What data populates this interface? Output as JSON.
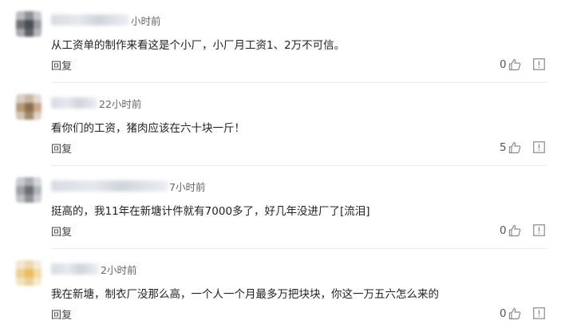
{
  "icons": {
    "like": "thumbs-up-icon",
    "report": "report-icon"
  },
  "colors": {
    "text": "#222222",
    "muted": "#666666",
    "icon": "#8a8a8a",
    "divider": "#ececec"
  },
  "comments": [
    {
      "time": "小时前",
      "content": "从工资单的制作来看这是个小厂，小厂月工资1、2万不可信。",
      "reply_label": "回复",
      "likes": "0"
    },
    {
      "time": "22小时前",
      "content": "看你们的工资，猪肉应该在六十块一斤！",
      "reply_label": "回复",
      "likes": "5"
    },
    {
      "time": "7小时前",
      "content": "挺高的，我11年在新塘计件就有7000多了，好几年没进厂了[流泪]",
      "reply_label": "回复",
      "likes": "0"
    },
    {
      "time": "2小时前",
      "content": "我在新塘，制衣厂没那么高，一个人一个月最多万把块块，你这一万五六怎么来的",
      "reply_label": "回复",
      "likes": "0"
    }
  ]
}
